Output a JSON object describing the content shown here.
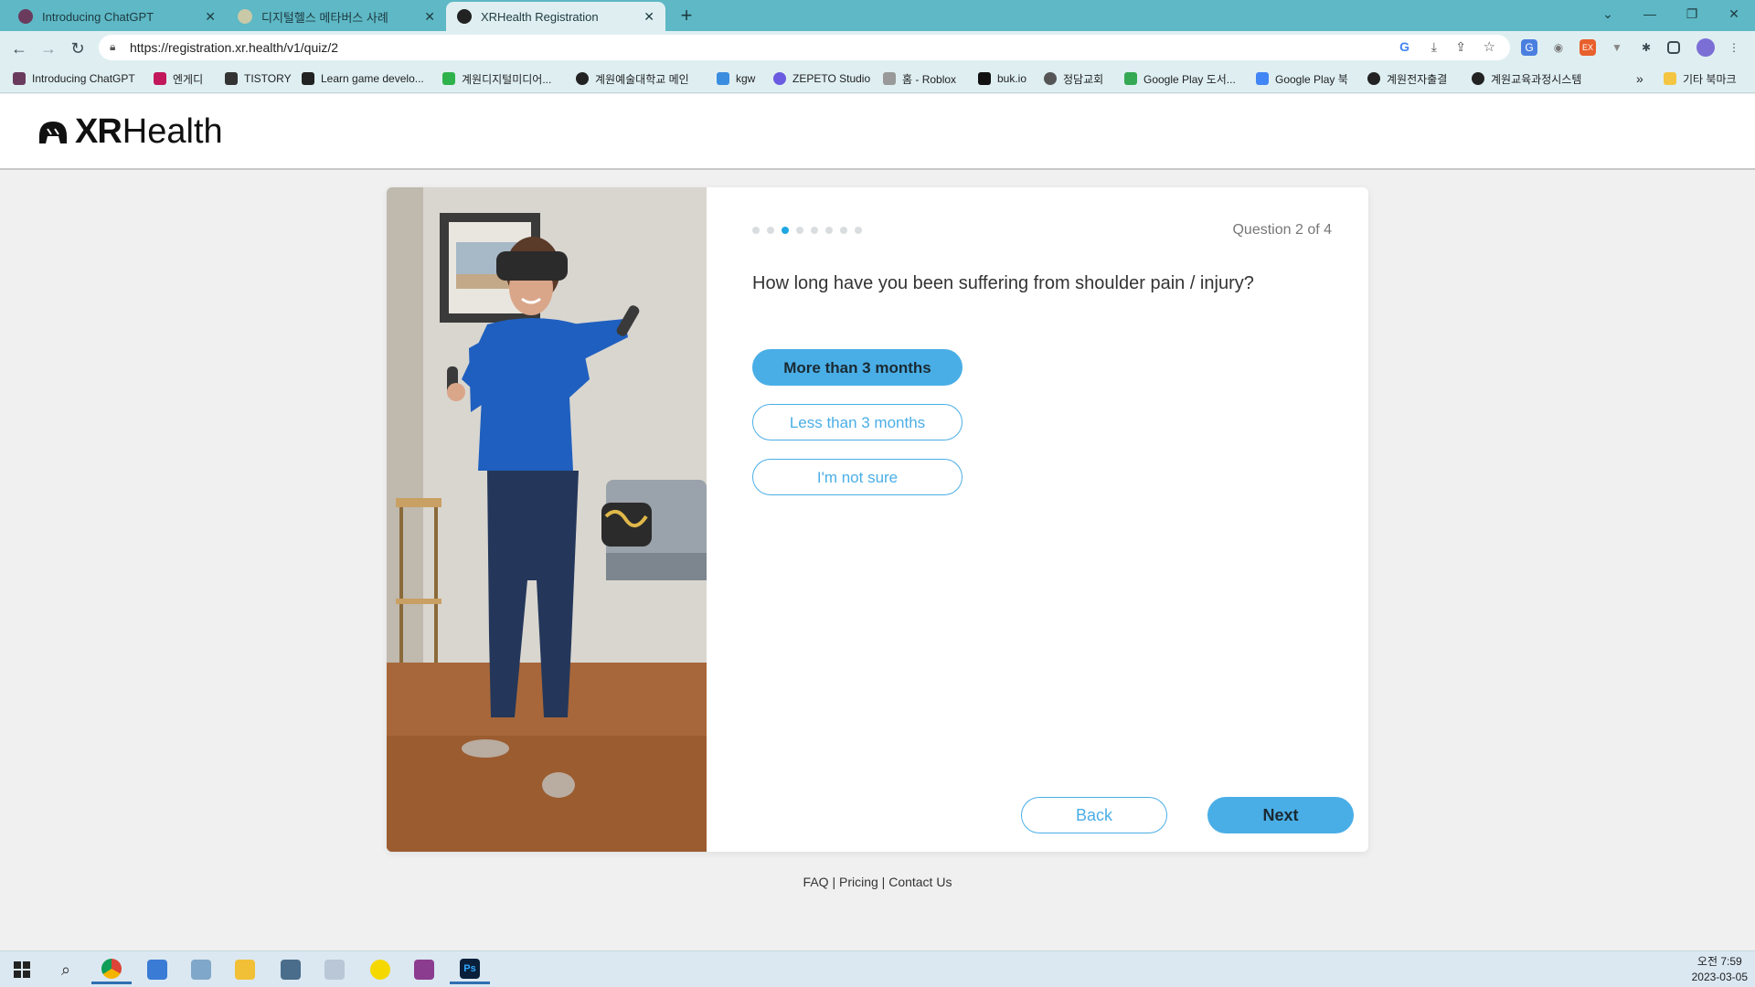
{
  "browser": {
    "tabs": [
      {
        "title": "Introducing ChatGPT",
        "color": "#6b3b5e"
      },
      {
        "title": "디지털헬스 메타버스 사례",
        "color": "#c9c9a8"
      },
      {
        "title": "XRHealth Registration",
        "color": "#222222"
      }
    ],
    "new_tab_symbol": "+",
    "url": "https://registration.xr.health/v1/quiz/2",
    "bookmarks": [
      {
        "label": "Introducing ChatGPT",
        "color": "#6b3b5e"
      },
      {
        "label": "엔게디",
        "color": "#c2185b"
      },
      {
        "label": "TISTORY",
        "color": "#333333"
      },
      {
        "label": "Learn game develo...",
        "color": "#222222"
      },
      {
        "label": "계원디지털미디어...",
        "color": "#2fb24c"
      },
      {
        "label": "계원예술대학교 메인",
        "color": "#222222"
      },
      {
        "label": "kgw",
        "color": "#3b8de0"
      },
      {
        "label": "ZEPETO Studio",
        "color": "#6a5be0"
      },
      {
        "label": "홈 - Roblox",
        "color": "#999999"
      },
      {
        "label": "buk.io",
        "color": "#111111"
      },
      {
        "label": "정담교회",
        "color": "#555555"
      },
      {
        "label": "Google Play 도서...",
        "color": "#34a853"
      },
      {
        "label": "Google Play 북",
        "color": "#4285f4"
      },
      {
        "label": "계원전자출결",
        "color": "#222222"
      },
      {
        "label": "계원교육과정시스템",
        "color": "#222222"
      }
    ],
    "more_bookmarks": "»",
    "other_bookmarks": "기타 북마크"
  },
  "site": {
    "logo_xr": "XR",
    "logo_health": "Health"
  },
  "quiz": {
    "step_count": 8,
    "current_step": 3,
    "question_counter": "Question 2 of 4",
    "question": "How long have you been suffering from shoulder pain / injury?",
    "options": [
      {
        "label": "More than 3 months",
        "selected": true
      },
      {
        "label": "Less than 3 months",
        "selected": false
      },
      {
        "label": "I'm not sure",
        "selected": false
      }
    ],
    "back_label": "Back",
    "next_label": "Next"
  },
  "footer": {
    "links": [
      "FAQ",
      "Pricing",
      "Contact Us"
    ],
    "separator": "|"
  },
  "taskbar": {
    "clock_line1": "오전 7:59",
    "clock_line2": "2023-03-05"
  },
  "colors": {
    "accent": "#4aaee6",
    "tab_strip": "#5eb8c5",
    "active_dot": "#1ea7e1"
  }
}
